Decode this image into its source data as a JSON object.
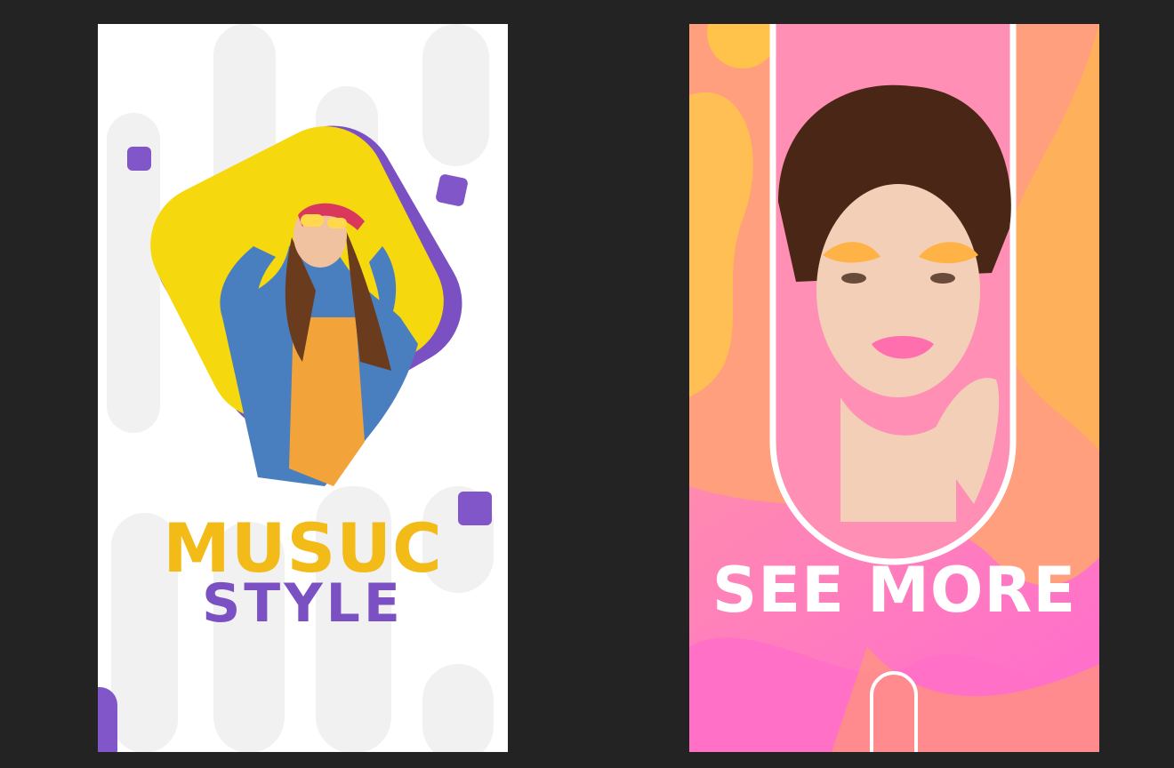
{
  "left_card": {
    "title_line1": "MUSUC",
    "title_line2": "STYLE",
    "colors": {
      "title": "#f3bb17",
      "subtitle": "#7b50c3",
      "accent": "#7b50c3",
      "frame_fill": "#f6d80e"
    }
  },
  "right_card": {
    "title": "SEE MORE",
    "colors": {
      "title": "#ffffff",
      "bg_orange": "#ff9d7e",
      "bg_pink": "#ff7bc2",
      "blob": "#ffc24a"
    }
  },
  "background_color": "#232323"
}
